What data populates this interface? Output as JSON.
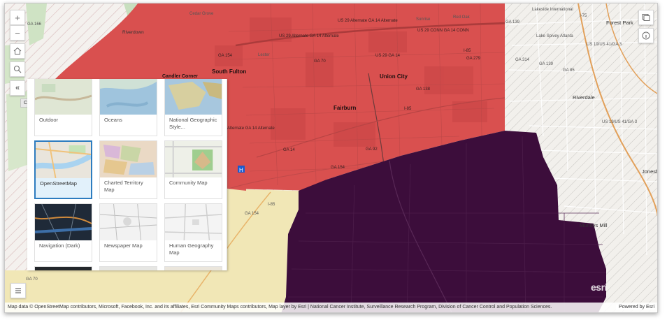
{
  "map": {
    "place_labels": [
      {
        "text": "Cedar Grove",
        "cls": "light"
      },
      {
        "text": "Riverdale",
        "cls": "big-gray"
      },
      {
        "text": "South Fulton",
        "cls": "big"
      },
      {
        "text": "Union City",
        "cls": "big"
      },
      {
        "text": "Fairburn",
        "cls": "big"
      },
      {
        "text": "Forest Park",
        "cls": "big-gray"
      },
      {
        "text": "Riverdale",
        "cls": "big-gray"
      },
      {
        "text": "Candler Corner",
        "cls": "big"
      },
      {
        "text": "Mundys Mill",
        "cls": "big-gray"
      },
      {
        "text": "Sunrise",
        "cls": "light"
      },
      {
        "text": "Red Oak",
        "cls": "light"
      },
      {
        "text": "Lake Spivey Atlanta",
        "cls": "light"
      },
      {
        "text": "Jonesboro",
        "cls": "big-gray"
      },
      {
        "text": "Lester",
        "cls": "light"
      },
      {
        "text": "Lakeside International",
        "cls": "light"
      }
    ],
    "road_labels": [
      "GA 166",
      "GA 139",
      "US 29 Alternate GA 14 Alternate",
      "US 29 Alternate GA 14 Alternate",
      "US 29 CONN GA 14 CONN",
      "GA 154",
      "GA 70",
      "US 29 GA 14",
      "GA 138",
      "I-85",
      "GA 279",
      "GA 314",
      "GA 139",
      "GA 85",
      "US 19/US 41/GA 3",
      "US 19/US 41/GA 3",
      "I-75",
      "I-85",
      "US 29 Alternate GA 14 Alternate",
      "GA 92",
      "GA 14",
      "GA 154",
      "GA 70",
      "I-85",
      "GA 154"
    ],
    "poi_labels": [
      "Lakeside International",
      "Lake Spivey Atlanta"
    ]
  },
  "controls": {
    "zoom_in": "+",
    "zoom_out": "−",
    "collapse_tooltip": "Collapse"
  },
  "basemap_gallery": {
    "tiles": [
      {
        "label": "Outdoor",
        "theme": "outdoor"
      },
      {
        "label": "Oceans",
        "theme": "oceans"
      },
      {
        "label": "National Geographic Style...",
        "theme": "natgeo"
      },
      {
        "label": "OpenStreetMap",
        "theme": "osm",
        "selected": true
      },
      {
        "label": "Charted Territory Map",
        "theme": "charted"
      },
      {
        "label": "Community Map",
        "theme": "community"
      },
      {
        "label": "Navigation (Dark)",
        "theme": "navdark"
      },
      {
        "label": "Newspaper Map",
        "theme": "newspaper"
      },
      {
        "label": "Human Geography Map",
        "theme": "humangeo"
      },
      {
        "label": "",
        "theme": "dark2"
      },
      {
        "label": "",
        "theme": "light2"
      },
      {
        "label": "",
        "theme": "light3"
      }
    ]
  },
  "attribution": {
    "text": "Map data © OpenStreetMap contributors, Microsoft, Facebook, Inc. and its affiliates, Esri Community Maps contributors, Map layer by Esri | National Cancer Institute, Surveillance Research Program, Division of Cancer Control and Population Sciences.",
    "powered_by": "Powered by Esri"
  },
  "colors": {
    "region_red": "#d9504f",
    "region_purple": "#3c0d3b",
    "region_tan": "#f1e7b6",
    "hatch": "#c9a9a9",
    "accent_selected": "#2d7cbf"
  }
}
